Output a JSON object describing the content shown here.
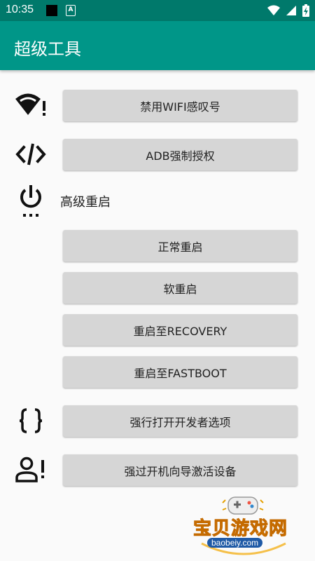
{
  "status_bar": {
    "time": "10:35",
    "notification_letter": "A"
  },
  "app_bar": {
    "title": "超级工具"
  },
  "rows": {
    "disable_wifi_exclaim": "禁用WIFI感叹号",
    "adb_force_auth": "ADB强制授权",
    "advanced_reboot_label": "高级重启",
    "normal_reboot": "正常重启",
    "soft_reboot": "软重启",
    "reboot_recovery": "重启至RECOVERY",
    "reboot_fastboot": "重启至FASTBOOT",
    "force_dev_options": "强行打开开发者选项",
    "bypass_setup_wizard": "强过开机向导激活设备"
  },
  "watermark": {
    "brand": "宝贝游戏网",
    "url": "baobeiy.com"
  },
  "colors": {
    "status_bar": "#00796b",
    "app_bar": "#009688",
    "button": "#d6d6d6"
  }
}
